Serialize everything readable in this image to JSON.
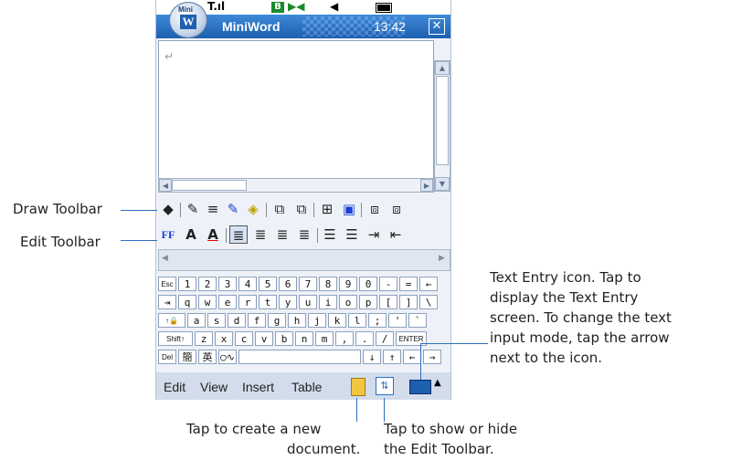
{
  "app": {
    "title": "MiniWord",
    "clock": "13:42",
    "logo_text": "Mini"
  },
  "status": {
    "signal": "T.ıl",
    "b_badge": "B"
  },
  "doc": {
    "cursor_mark": "↵"
  },
  "menus": [
    "Edit",
    "View",
    "Insert",
    "Table"
  ],
  "keyboard": {
    "row1": [
      "Esc",
      "1",
      "2",
      "3",
      "4",
      "5",
      "6",
      "7",
      "8",
      "9",
      "0",
      "-",
      "=",
      "←"
    ],
    "row2": [
      "⇥",
      "q",
      "w",
      "e",
      "r",
      "t",
      "y",
      "u",
      "i",
      "o",
      "p",
      "[",
      "]",
      "\\"
    ],
    "row3": [
      "↑🔒",
      "a",
      "s",
      "d",
      "f",
      "g",
      "h",
      "j",
      "k",
      "l",
      ";",
      "'",
      "`"
    ],
    "row4": [
      "Shift↑",
      "z",
      "x",
      "c",
      "v",
      "b",
      "n",
      "m",
      ",",
      ".",
      "/",
      "ENTER"
    ],
    "row5": [
      "Del",
      "簡",
      "英",
      "○∿",
      " ",
      "↓",
      "↑",
      "←",
      "→"
    ]
  },
  "annotations": {
    "draw_toolbar": "Draw Toolbar",
    "edit_toolbar": "Edit Toolbar",
    "text_entry_1": "Text Entry icon. Tap to",
    "text_entry_2": "display the Text Entry",
    "text_entry_3": "screen. To change the text",
    "text_entry_4": "input mode, tap the arrow",
    "text_entry_5": "next to the icon.",
    "new_doc_1": "Tap to create a new",
    "new_doc_2": "document.",
    "edit_toggle_1": "Tap to show or hide",
    "edit_toggle_2": "the Edit Toolbar."
  },
  "colors": {
    "titlebar": "#2a72c8",
    "annotation_line": "#2b6fc4"
  }
}
